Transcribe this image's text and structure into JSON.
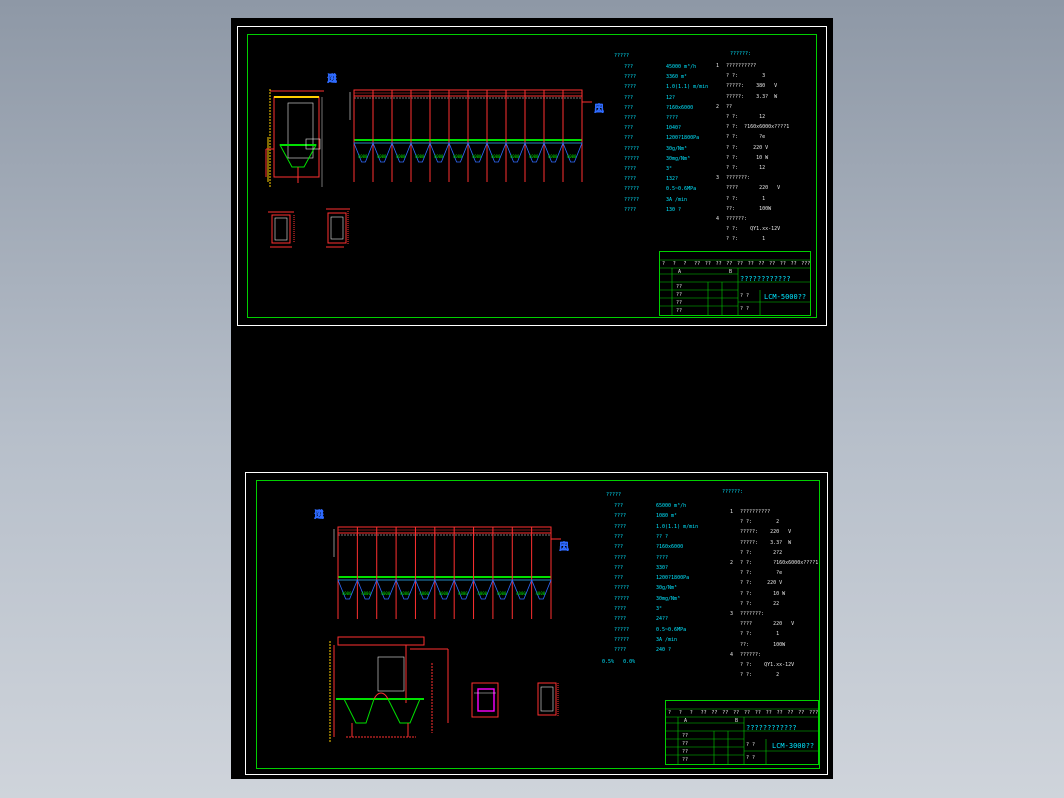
{
  "colors": {
    "background": "#000000",
    "frame": "#00d000",
    "text": "#00e5ff",
    "structure": "#ff2020",
    "hopper_band": "#00e000",
    "inlet_outlet": "#2f6bff",
    "accent": "#ff00ff"
  },
  "sheet1": {
    "specs_header": "?????",
    "specs": [
      {
        "k": "???",
        "v": "45000 m³/h"
      },
      {
        "k": "????",
        "v": "3360 m²"
      },
      {
        "k": "????",
        "v": "1.0(1.1) m/min"
      },
      {
        "k": "???",
        "v": "12?"
      },
      {
        "k": "???",
        "v": "?160x6000"
      },
      {
        "k": "????",
        "v": "????"
      },
      {
        "k": "???",
        "v": "1040?"
      },
      {
        "k": "???",
        "v": "1200?1800Pa"
      },
      {
        "k": "?????",
        "v": "30g/Nm³"
      },
      {
        "k": "?????",
        "v": "30mg/Nm³"
      },
      {
        "k": "????",
        "v": "3°"
      },
      {
        "k": "????",
        "v": "132?"
      },
      {
        "k": "?????",
        "v": "0.5~0.6MPa"
      },
      {
        "k": "?????",
        "v": "3A /min"
      },
      {
        "k": "????",
        "v": "130 ?"
      }
    ],
    "req_header": "??????:",
    "requirements": [
      {
        "n": "1",
        "t": "??????????"
      },
      {
        "n": "",
        "t": "? ?:        3"
      },
      {
        "n": "",
        "t": "?????:    380   V"
      },
      {
        "n": "",
        "t": "?????:    3.3?  W"
      },
      {
        "n": "2",
        "t": "??"
      },
      {
        "n": "",
        "t": "? ?:       12"
      },
      {
        "n": "",
        "t": "? ?:  ?160x6000x????1"
      },
      {
        "n": "",
        "t": "? ?:       ?e"
      },
      {
        "n": "",
        "t": "? ?:     220 V"
      },
      {
        "n": "",
        "t": "? ?:      10 W"
      },
      {
        "n": "",
        "t": "? ?:       12"
      },
      {
        "n": "3",
        "t": "???????:"
      },
      {
        "n": "",
        "t": "????       220   V"
      },
      {
        "n": "",
        "t": "? ?:        1"
      },
      {
        "n": "",
        "t": "??:        100W"
      },
      {
        "n": "4",
        "t": "??????:"
      },
      {
        "n": "",
        "t": "? ?:    QY1.xx-12V"
      },
      {
        "n": "",
        "t": "? ?:        1"
      }
    ],
    "dust_labels": [
      "4000",
      "4000",
      "4000",
      "4000",
      "4000",
      "4000",
      "4000",
      "4000",
      "4000",
      "4000",
      "4000",
      "4000"
    ],
    "inlet": [
      "进",
      "风",
      "口"
    ],
    "outlet": [
      "出",
      "风",
      "口"
    ],
    "title_block": {
      "row_top": [
        "?",
        "?",
        "?",
        "??",
        "??",
        "??",
        "??",
        "??",
        "??",
        "??",
        "??",
        "??",
        "??",
        "???"
      ],
      "col_a": "A",
      "col_b": "B",
      "project": "????????????",
      "drawing_no": "LCM-5000??",
      "scale_labels": [
        "? ?",
        "? ?"
      ],
      "left_rows": [
        "??",
        "??",
        "??",
        "??"
      ]
    }
  },
  "sheet2": {
    "specs_header": "?????",
    "specs": [
      {
        "k": "???",
        "v": "65000 m³/h"
      },
      {
        "k": "????",
        "v": "1080 m²"
      },
      {
        "k": "????",
        "v": "1.0(1.1) m/min"
      },
      {
        "k": "???",
        "v": "?? ?"
      },
      {
        "k": "???",
        "v": "?160x6000"
      },
      {
        "k": "????",
        "v": "????"
      },
      {
        "k": "???",
        "v": "330?"
      },
      {
        "k": "???",
        "v": "1200?1800Pa"
      },
      {
        "k": "?????",
        "v": "30g/Nm³"
      },
      {
        "k": "?????",
        "v": "30mg/Nm³"
      },
      {
        "k": "????",
        "v": "3°"
      },
      {
        "k": "????",
        "v": "24??"
      },
      {
        "k": "?????",
        "v": "0.5~0.6MPa"
      },
      {
        "k": "?????",
        "v": "3A /min"
      },
      {
        "k": "????",
        "v": "240 ?"
      }
    ],
    "note": "0.5%   0.0%",
    "req_header": "??????:",
    "requirements": [
      {
        "n": "1",
        "t": "??????????"
      },
      {
        "n": "",
        "t": "? ?:        2"
      },
      {
        "n": "",
        "t": "?????:    220   V"
      },
      {
        "n": "",
        "t": "?????:    3.3?  W"
      },
      {
        "n": "",
        "t": "? ?:       2?2"
      },
      {
        "n": "2",
        "t": "? ?:       ?160x6000x????1"
      },
      {
        "n": "",
        "t": "? ?:        ?e"
      },
      {
        "n": "",
        "t": "? ?:     220 V"
      },
      {
        "n": "",
        "t": "? ?:       10 W"
      },
      {
        "n": "",
        "t": "? ?:       22"
      },
      {
        "n": "3",
        "t": "???????:"
      },
      {
        "n": "",
        "t": "????       220   V"
      },
      {
        "n": "",
        "t": "? ?:        1"
      },
      {
        "n": "",
        "t": "??:        100W"
      },
      {
        "n": "4",
        "t": "??????:"
      },
      {
        "n": "",
        "t": "? ?:    QY1.xx-12V"
      },
      {
        "n": "",
        "t": "? ?:        2"
      }
    ],
    "dust_labels": [
      "4000",
      "4000",
      "4000",
      "4000",
      "4000",
      "4000",
      "4000",
      "4000",
      "4000",
      "4000",
      "4000"
    ],
    "inlet": [
      "进",
      "风",
      "口"
    ],
    "outlet": [
      "出",
      "风",
      "口"
    ],
    "title_block": {
      "row_top": [
        "?",
        "?",
        "?",
        "??",
        "??",
        "??",
        "??",
        "??",
        "??",
        "??",
        "??",
        "??",
        "??",
        "???"
      ],
      "col_a": "A",
      "col_b": "B",
      "project": "????????????",
      "drawing_no": "LCM-3000??",
      "scale_labels": [
        "? ?",
        "? ?"
      ],
      "left_rows": [
        "??",
        "??",
        "??",
        "??"
      ]
    }
  }
}
